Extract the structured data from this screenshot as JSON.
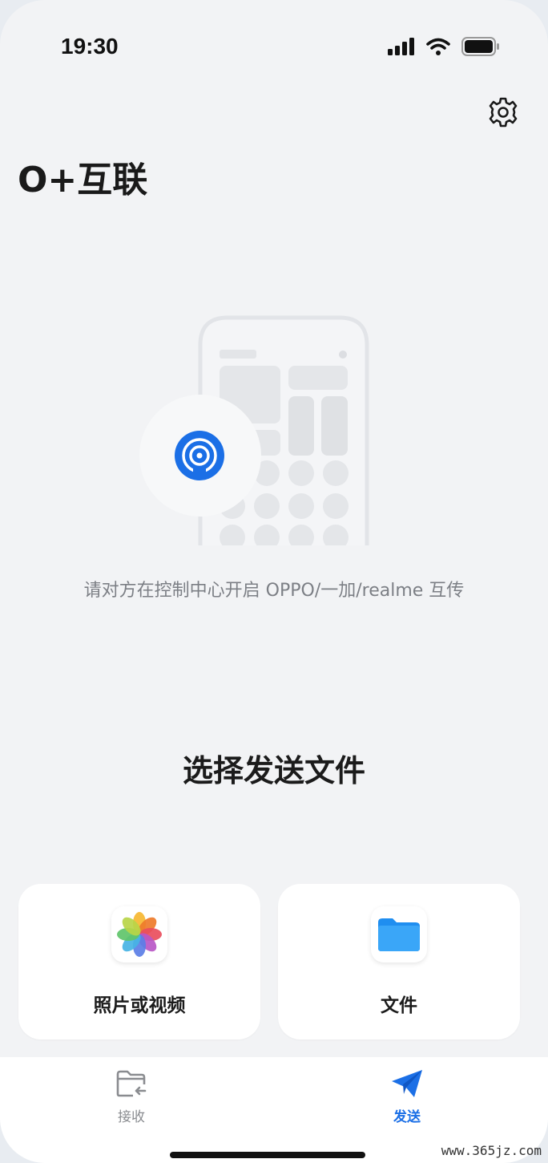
{
  "status_bar": {
    "time": "19:30",
    "icons": [
      "signal-icon",
      "wifi-icon",
      "battery-icon"
    ]
  },
  "header": {
    "title": "O+互联",
    "settings_icon": "gear-icon"
  },
  "main": {
    "hint": "请对方在控制中心开启 OPPO/一加/realme 互传",
    "section_title": "选择发送文件",
    "cards": [
      {
        "label": "照片或视频",
        "icon": "photos-icon"
      },
      {
        "label": "文件",
        "icon": "folder-icon"
      }
    ]
  },
  "tabbar": {
    "tabs": [
      {
        "label": "接收",
        "icon": "receive-folder-icon",
        "active": false
      },
      {
        "label": "发送",
        "icon": "send-plane-icon",
        "active": true
      }
    ]
  },
  "watermark": "www.365jz.com",
  "colors": {
    "accent": "#1b6fe6",
    "background": "#f2f3f5"
  }
}
